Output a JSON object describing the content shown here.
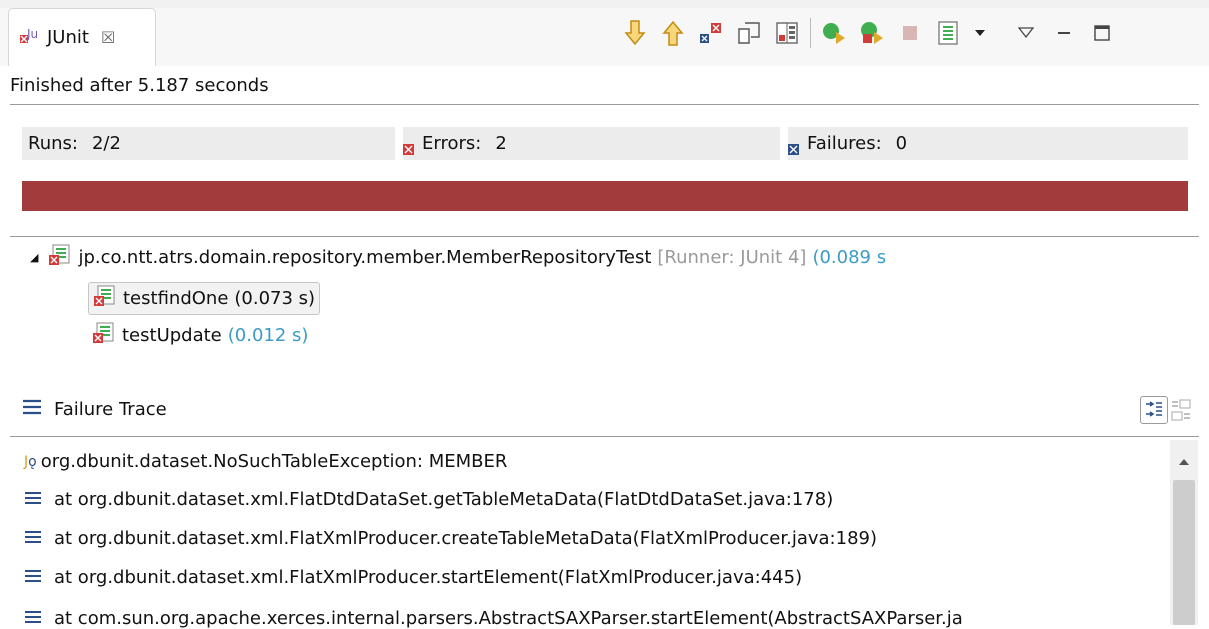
{
  "tab": {
    "title": "JUnit",
    "close_glyph": "☒",
    "icon": "junit-icon"
  },
  "toolbar": {
    "icons": [
      "next-failure-icon",
      "previous-failure-icon",
      "show-failures-only-icon",
      "scroll-lock-icon",
      "show-skipped-icon",
      "rerun-test-icon",
      "rerun-failed-first-icon",
      "stop-icon",
      "test-run-history-icon",
      "history-dropdown-icon",
      "view-menu-icon",
      "minimize-icon",
      "maximize-icon"
    ]
  },
  "status": "Finished after 5.187 seconds",
  "counters": {
    "runs_label": "Runs:",
    "runs_value": "2/2",
    "errors_label": "Errors:",
    "errors_value": "2",
    "failures_label": "Failures:",
    "failures_value": "0"
  },
  "progress": {
    "status": "failed",
    "color": "#a23c3c",
    "fraction": 1.0
  },
  "tree": {
    "suite": {
      "name": "jp.co.ntt.atrs.domain.repository.member.MemberRepositoryTest",
      "runner": "[Runner: JUnit 4]",
      "time": "(0.089 s"
    },
    "tests": [
      {
        "name": "testfindOne",
        "time": "(0.073 s)",
        "selected": true
      },
      {
        "name": "testUpdate",
        "time": "(0.012 s)",
        "selected": false
      }
    ]
  },
  "failure_trace": {
    "title": "Failure Trace",
    "lines": [
      "org.dbunit.dataset.NoSuchTableException: MEMBER",
      "at org.dbunit.dataset.xml.FlatDtdDataSet.getTableMetaData(FlatDtdDataSet.java:178)",
      "at org.dbunit.dataset.xml.FlatXmlProducer.createTableMetaData(FlatXmlProducer.java:189)",
      "at org.dbunit.dataset.xml.FlatXmlProducer.startElement(FlatXmlProducer.java:445)",
      "at com.sun.org.apache.xerces.internal.parsers.AbstractSAXParser.startElement(AbstractSAXParser.ja"
    ]
  },
  "colors": {
    "error_red": "#d33b3b",
    "failure_blue": "#2c4f8a",
    "bar_red": "#a23c3c",
    "time_blue": "#3c9bc6"
  }
}
